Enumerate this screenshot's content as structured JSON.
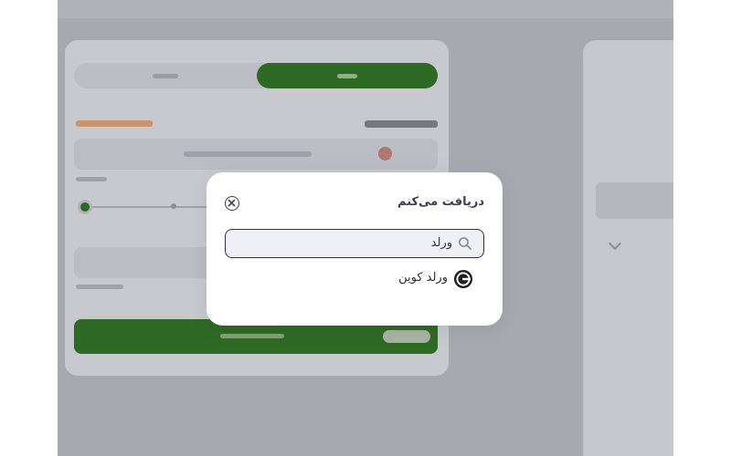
{
  "modal": {
    "title": "دریافت می‌کنم",
    "close_icon": "close-circle-icon",
    "search": {
      "value": "ورلد",
      "placeholder": "",
      "icon": "search-icon"
    },
    "results": [
      {
        "label": "ورلد کوین",
        "icon": "worldcoin-icon"
      }
    ]
  },
  "colors": {
    "overlay": "#a8a8b0",
    "accent_green": "#2f6a24",
    "modal_border": "#2f2f5c",
    "title_text": "#3c3c58"
  }
}
